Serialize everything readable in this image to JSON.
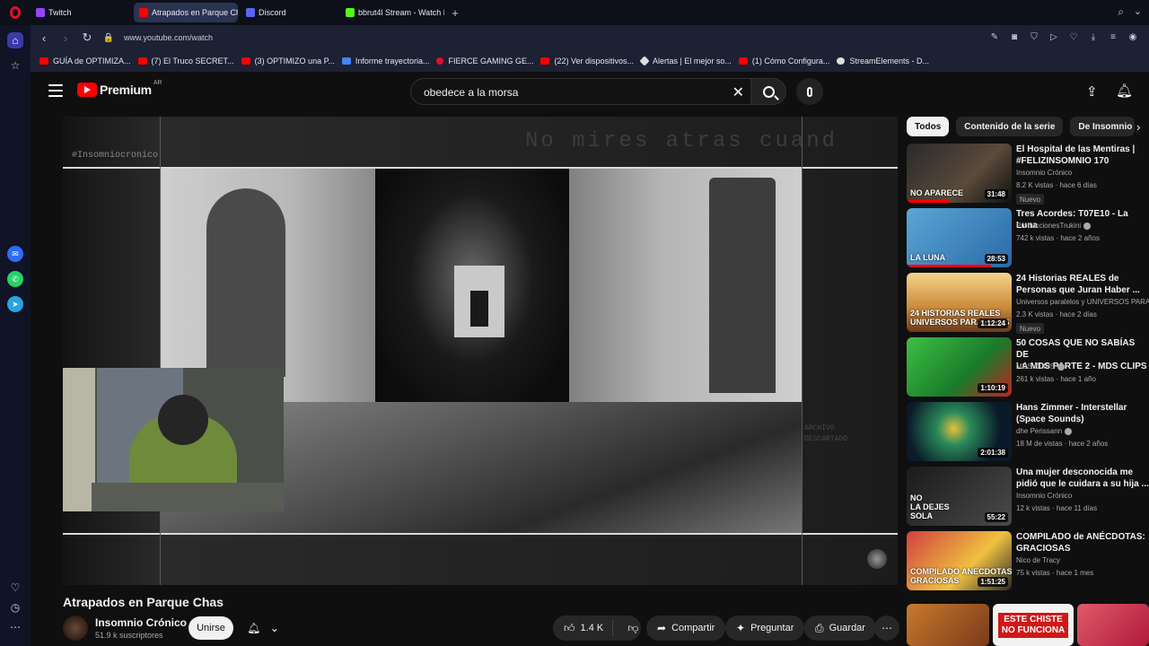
{
  "browser": {
    "tabs": [
      {
        "label": "Twitch",
        "color": "#9146ff"
      },
      {
        "label": "Atrapados en Parque Cha",
        "color": "#ff0000"
      },
      {
        "label": "Discord",
        "color": "#5865f2"
      },
      {
        "label": "bbrut4l Stream - Watch Li",
        "color": "#53fc18"
      }
    ],
    "url": "www.youtube.com/watch",
    "bookmarks": [
      {
        "label": "GUÍA de OPTIMIZA...",
        "color": "#ff0000"
      },
      {
        "label": "(7) El Truco SECRET...",
        "color": "#ff0000"
      },
      {
        "label": "(3) OPTIMIZO una P...",
        "color": "#ff0000"
      },
      {
        "label": "Informe trayectoria...",
        "color": "#4285f4"
      },
      {
        "label": "FIERCE GAMING GE...",
        "color": "#e0102a"
      },
      {
        "label": "(22) Ver dispositivos...",
        "color": "#ff0000"
      },
      {
        "label": "Alertas | El mejor so...",
        "color": "#dddddd"
      },
      {
        "label": "(1) Cómo Configura...",
        "color": "#ff0000"
      },
      {
        "label": "StreamElements - D...",
        "color": "#dddddd"
      }
    ]
  },
  "youtube": {
    "logo": "Premium",
    "region": "AR",
    "search_value": "obedece a la morsa"
  },
  "video": {
    "watermark_tag": "#Insomniocronico",
    "watermark_text": "No mires atras cuand",
    "side_text": "ARCHIVO\nDESCARTADO",
    "title": "Atrapados en Parque Chas",
    "channel": "Insomnio Crónico",
    "subscribers": "51.9 k suscriptores",
    "join_label": "Unirse",
    "likes": "1.4 K",
    "share_label": "Compartir",
    "ask_label": "Preguntar",
    "save_label": "Guardar"
  },
  "chips": [
    "Todos",
    "Contenido de la serie",
    "De Insomnio Crónico"
  ],
  "recommendations": [
    {
      "title": "El Hospital de las Mentiras |\n#FELIZINSOMNIO 170",
      "channel": "Insomnio Crónico",
      "meta": "8.2 K vistas · hace 6 días",
      "duration": "31:48",
      "badge": "Nuevo",
      "verified": false
    },
    {
      "title": "Tres Acordes: T07E10 - La Luna",
      "channel": "ProduccionesTrukini",
      "meta": "742 k vistas · hace 2 años",
      "duration": "28:53",
      "badge": "",
      "verified": true
    },
    {
      "title": "24 Historias REALES de\nPersonas que Juran Haber ...",
      "channel": "Universos paralelos y UNIVERSOS PARALELOS",
      "meta": "2.3 K vistas · hace 2 días",
      "duration": "1:12:24",
      "badge": "Nuevo",
      "verified": false
    },
    {
      "title": "50 COSAS QUE NO SABÍAS DE\nLA MDS PARTE 2 - MDS CLIPS",
      "channel": "MDS CLIPS",
      "meta": "261 k vistas · hace 1 año",
      "duration": "1:10:19",
      "badge": "",
      "verified": true
    },
    {
      "title": "Hans Zimmer - Interstellar\n(Space Sounds)",
      "channel": "dhe Perissann",
      "meta": "18 M de vistas · hace 2 años",
      "duration": "2:01:38",
      "badge": "",
      "verified": true
    },
    {
      "title": "Una mujer desconocida me\npidió que le cuidara a su hija ...",
      "channel": "Insomnio Crónico",
      "meta": "12 k vistas · hace 11 días",
      "duration": "55:22",
      "badge": "",
      "verified": false
    },
    {
      "title": "COMPILADO de ANÉCDOTAS:\nGRACIOSAS",
      "channel": "Nico de Tracy",
      "meta": "75 k vistas · hace 1 mes",
      "duration": "1:51:25",
      "badge": "",
      "verified": false
    }
  ],
  "thumb_texts": [
    "NO APARECE",
    "LA LUNA",
    "24 HISTORIAS REALES\nUNIVERSOS PARALELOS",
    "",
    "",
    "NO\nLA DEJES\nSOLA",
    "COMPILADO ANECDOTAS\nGRACIOSAS"
  ],
  "bottom_thumb_text": "ESTE CHISTE\nNO FUNCIONA"
}
